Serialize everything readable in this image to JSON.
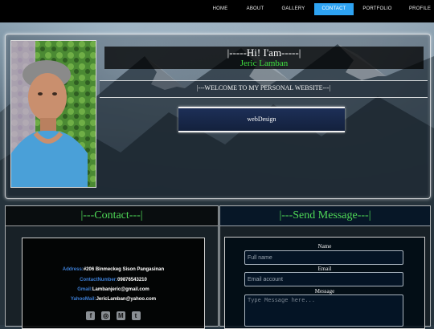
{
  "nav": {
    "items": [
      {
        "label": "HOME"
      },
      {
        "label": "ABOUT"
      },
      {
        "label": "GALLERY"
      },
      {
        "label": "CONTACT"
      },
      {
        "label": "PORTFOLIO"
      },
      {
        "label": "PROFILE"
      }
    ],
    "active": "CONTACT"
  },
  "hero": {
    "greeting": "|-----Hi! I'am-----|",
    "name": "Jeric Lamban",
    "welcome": "|---WELCOME TO MY PERSONAL WEBSITE---|",
    "button": "webDesign"
  },
  "contact": {
    "heading": "|---Contact---|",
    "address_label": "Address:",
    "address": "#206 Binmeckeg Sison Pangasinan",
    "number_label": "ContactNumber:",
    "number": "09876543210",
    "gmail_label": "Gmail:",
    "gmail": "Lambanjeric@gmail.com",
    "yahoo_label": "YahooMail:",
    "yahoo": "JericLamban@yahoo.com",
    "social_icons": [
      "facebook-icon",
      "instagram-icon",
      "gmail-icon",
      "twitter-icon"
    ]
  },
  "message": {
    "heading": "|---Send Message---|",
    "name_label": "Name",
    "name_placeholder": "Full name",
    "email_label": "Email",
    "email_placeholder": "Email account",
    "message_label": "Message",
    "message_placeholder": "Type Message here..."
  },
  "colors": {
    "nav_active": "#2ea3f2",
    "name_green": "#3fe03f",
    "label_blue": "#3d7fd6"
  }
}
